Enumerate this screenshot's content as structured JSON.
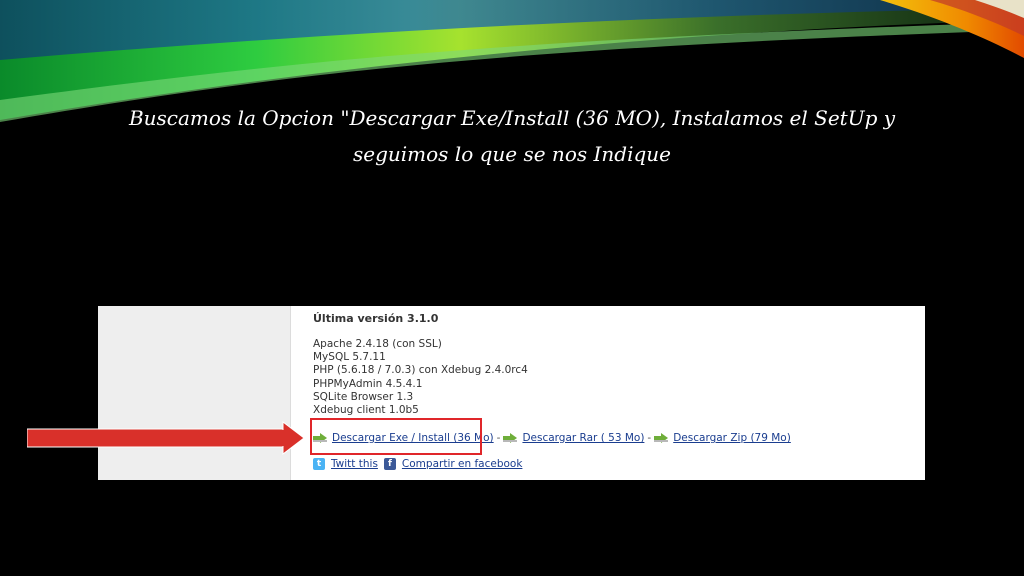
{
  "slide": {
    "title": "Buscamos la Opcion \"Descargar Exe/Install (36 MO), Instalamos el SetUp y seguimos lo que se nos Indique"
  },
  "screenshot": {
    "version_heading": "Última versión 3.1.0",
    "components": [
      "Apache 2.4.18 (con SSL)",
      "MySQL 5.7.11",
      "PHP (5.6.18 / 7.0.3) con Xdebug 2.4.0rc4",
      "PHPMyAdmin 4.5.4.1",
      "SQLite Browser 1.3",
      "Xdebug client 1.0b5"
    ],
    "downloads": {
      "exe": "Descargar Exe / Install (36 Mo)",
      "rar": "Descargar Rar ( 53 Mo)",
      "zip": "Descargar Zip (79 Mo)",
      "separator": "-"
    },
    "social": {
      "twitter": "Twitt this",
      "facebook": "Compartir en facebook"
    }
  },
  "colors": {
    "highlight": "#e0262a",
    "arrow": "#d9302a",
    "link": "#1a3d8f"
  }
}
